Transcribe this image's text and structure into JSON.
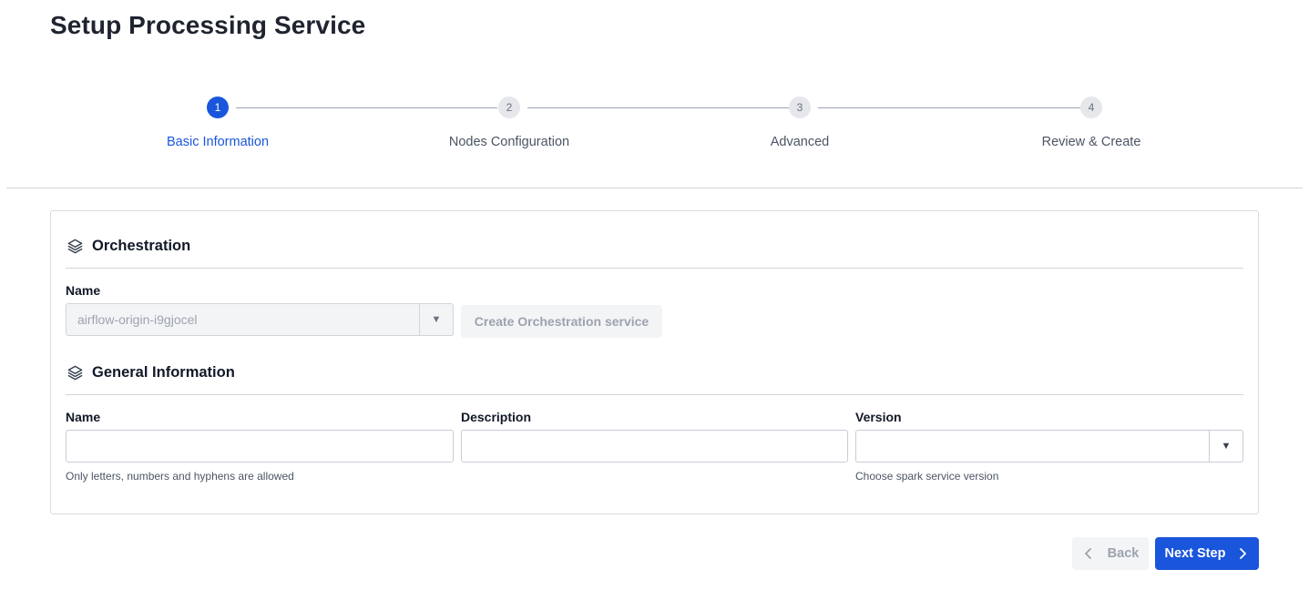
{
  "page": {
    "title": "Setup Processing Service"
  },
  "stepper": {
    "steps": [
      {
        "number": "1",
        "label": "Basic Information",
        "state": "active"
      },
      {
        "number": "2",
        "label": "Nodes Configuration",
        "state": "pending"
      },
      {
        "number": "3",
        "label": "Advanced",
        "state": "pending"
      },
      {
        "number": "4",
        "label": "Review & Create",
        "state": "pending"
      }
    ]
  },
  "orchestration": {
    "title": "Orchestration",
    "icon": "layers-icon",
    "name_label": "Name",
    "name_value": "airflow-origin-i9gjocel",
    "create_button": "Create Orchestration service"
  },
  "general": {
    "title": "General Information",
    "icon": "layers-icon",
    "name_label": "Name",
    "name_value": "",
    "name_hint": "Only letters, numbers and hyphens are allowed",
    "description_label": "Description",
    "description_value": "",
    "version_label": "Version",
    "version_value": "",
    "version_hint": "Choose spark service version"
  },
  "footer": {
    "back_label": "Back",
    "next_label": "Next Step"
  },
  "colors": {
    "accent": "#1a56db",
    "disabled_bg": "#f3f4f6",
    "border": "#d1d5db"
  }
}
